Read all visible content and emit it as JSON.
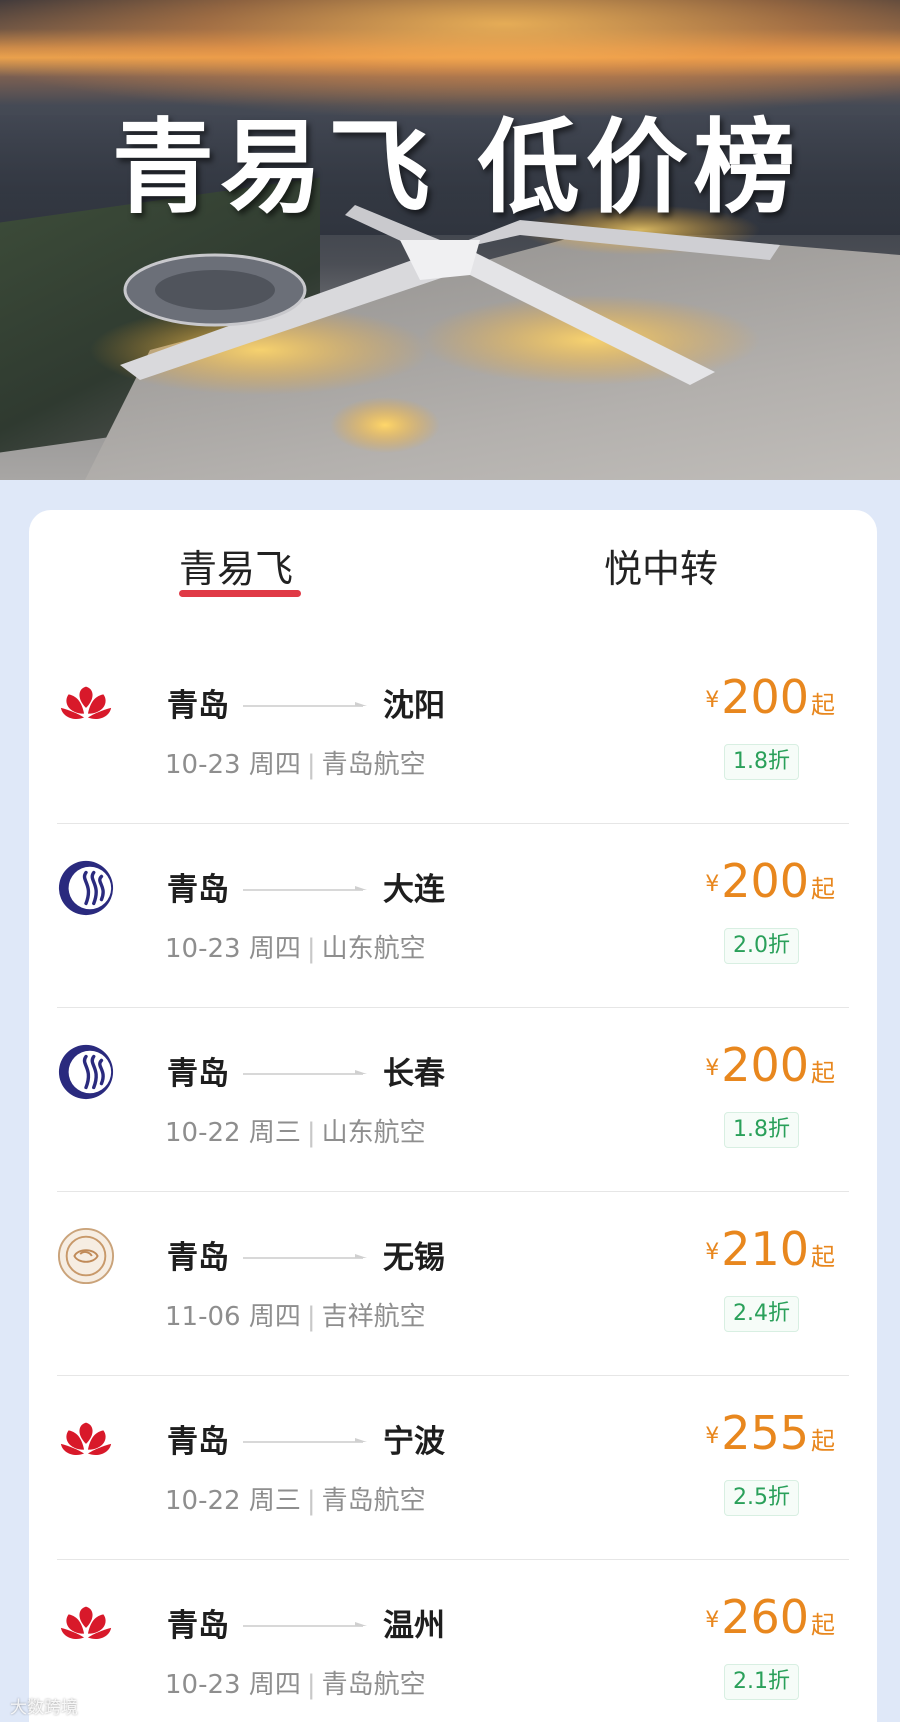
{
  "banner": {
    "title": "青易飞 低价榜"
  },
  "tabs": [
    {
      "label": "青易飞",
      "active": true
    },
    {
      "label": "悦中转",
      "active": false
    }
  ],
  "accent_color": "#e03a46",
  "price_color": "#e8871e",
  "discount_color": "#2aa05a",
  "routes": [
    {
      "from": "青岛",
      "to": "沈阳",
      "date": "10-23 周四",
      "airline": "青岛航空",
      "airline_icon": "qingdao-airlines-logo-icon",
      "currency": "¥",
      "price": "200",
      "suffix": "起",
      "discount": "1.8折"
    },
    {
      "from": "青岛",
      "to": "大连",
      "date": "10-23 周四",
      "airline": "山东航空",
      "airline_icon": "shandong-airlines-logo-icon",
      "currency": "¥",
      "price": "200",
      "suffix": "起",
      "discount": "2.0折"
    },
    {
      "from": "青岛",
      "to": "长春",
      "date": "10-22 周三",
      "airline": "山东航空",
      "airline_icon": "shandong-airlines-logo-icon",
      "currency": "¥",
      "price": "200",
      "suffix": "起",
      "discount": "1.8折"
    },
    {
      "from": "青岛",
      "to": "无锡",
      "date": "11-06 周四",
      "airline": "吉祥航空",
      "airline_icon": "juneyao-airlines-logo-icon",
      "currency": "¥",
      "price": "210",
      "suffix": "起",
      "discount": "2.4折"
    },
    {
      "from": "青岛",
      "to": "宁波",
      "date": "10-22 周三",
      "airline": "青岛航空",
      "airline_icon": "qingdao-airlines-logo-icon",
      "currency": "¥",
      "price": "255",
      "suffix": "起",
      "discount": "2.5折"
    },
    {
      "from": "青岛",
      "to": "温州",
      "date": "10-23 周四",
      "airline": "青岛航空",
      "airline_icon": "qingdao-airlines-logo-icon",
      "currency": "¥",
      "price": "260",
      "suffix": "起",
      "discount": "2.1折"
    }
  ],
  "watermark": "大数跨境"
}
